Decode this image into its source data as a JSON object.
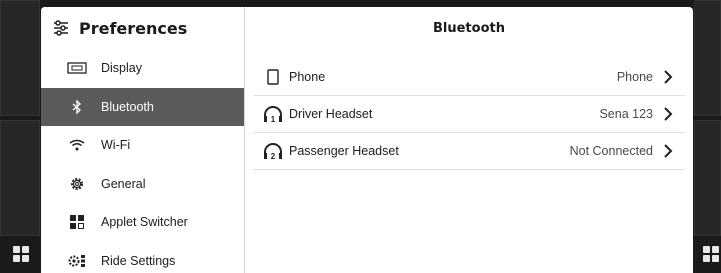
{
  "sidebar": {
    "title": "Preferences",
    "title_icon": "preferences-sliders-icon",
    "items": [
      {
        "label": "Display",
        "icon": "display-icon",
        "active": false
      },
      {
        "label": "Bluetooth",
        "icon": "bluetooth-icon",
        "active": true
      },
      {
        "label": "Wi-Fi",
        "icon": "wifi-icon",
        "active": false
      },
      {
        "label": "General",
        "icon": "gear-icon",
        "active": false
      },
      {
        "label": "Applet Switcher",
        "icon": "applet-switcher-icon",
        "active": false
      },
      {
        "label": "Ride Settings",
        "icon": "ride-settings-icon",
        "active": false
      }
    ]
  },
  "content": {
    "title": "Bluetooth",
    "devices": [
      {
        "label": "Phone",
        "value": "Phone",
        "icon": "phone-icon"
      },
      {
        "label": "Driver Headset",
        "value": "Sena 123",
        "icon": "headset-1-icon"
      },
      {
        "label": "Passenger Headset",
        "value": "Not Connected",
        "icon": "headset-2-icon"
      }
    ]
  },
  "colors": {
    "active_nav_bg": "#5b5b5b",
    "background": "#1a1a1a",
    "panel": "#ffffff"
  }
}
